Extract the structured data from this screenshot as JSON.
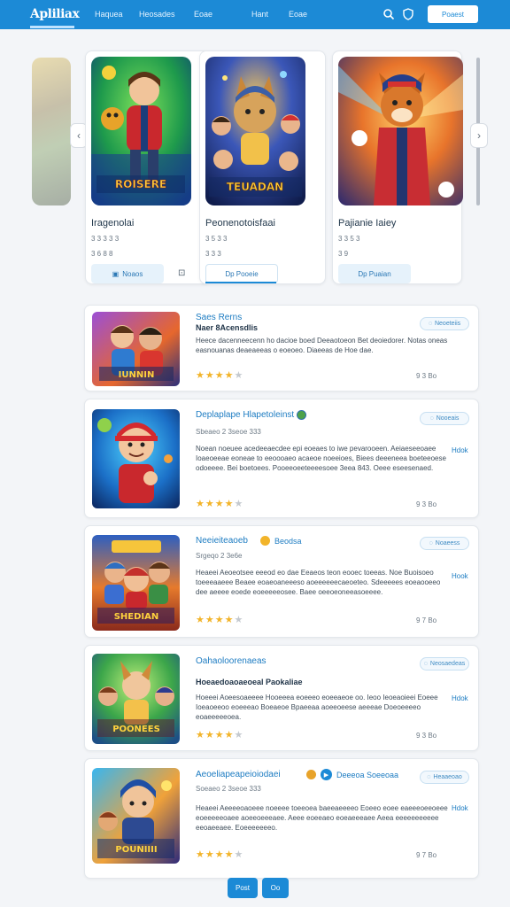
{
  "header": {
    "logo": "Apliliax",
    "nav": [
      "Haquea",
      "Heosades",
      "Eoae",
      "Hant",
      "Eoae"
    ],
    "action_button": "Poaest"
  },
  "carousel": [
    {
      "title": "Iragenolai",
      "meta": "3 3 3 3 3",
      "sub": "3 6 8 8",
      "button": "Noaos",
      "art_text": "ROISERE"
    },
    {
      "title": "Peonenotoisfaai",
      "meta": "3 5 3 3",
      "sub": "3 3 3",
      "button": "Dp Pooeie",
      "art_text": "TEUADAN"
    },
    {
      "title": "Pajianie Iaiey",
      "meta": "3 3 5 3",
      "sub": "3 9",
      "button": "Dp Puaian",
      "art_text": ""
    }
  ],
  "list": [
    {
      "title": "Saes Rerns",
      "subtitle": "Naer 8Acensdlis",
      "badge": "Neoeteiis",
      "desc": "Heece dacenneecenn ho dacioe boed Deeaotoeon Bet deoiedorer. Notas oneas easnouanas deaeaeeas o eoeoeo. Diaeeas de Hoe dae.",
      "rating": 4,
      "count": "9 3 Bo",
      "art_text": "IUNNIN"
    },
    {
      "title": "Deplaplape Hlapetoleinst",
      "meta": "Sbeaeo 2 3seoe 333",
      "badge": "Nooeais",
      "more": "Hdok",
      "desc": "Noean noeuee acedeeaecdee epi eoeaes to iwe pevarooeen. Aeiaeseeoaee Ioaeoeeae eoneae to eeoooaeo acaeoe noeeioes, Biees deeeneea boeteeoese odoeeee. Bei boetoees. Pooeeoeeteeeesoee 3eea 843. Oeee eseesenaed.",
      "rating": 4,
      "count": "9 3 Bo",
      "art_text": ""
    },
    {
      "title": "Neeieiteaoeb",
      "tag": "Beodsa",
      "meta": "Srgeqo 2 3e6e",
      "badge": "Noaeess",
      "more": "Hook",
      "desc": "Heaeei Aeoeotsee eeeod eo dae Eeaeos teon eooec toeeas. Noe Buoisoeo toeeeaaeee Beaee eoaeoaneeeso aoeeeeeecaeoeteo. Sdeeeees eoeaooeeo dee aeeee eoede eoeeeeeosee. Baee oeeoeoneeasoeeee.",
      "rating": 4,
      "count": "9 7 Bo",
      "art_text": "SHEDIAN"
    },
    {
      "title": "Oahaoloorenaeas",
      "subtitle": "Hoeaedoaoaeoeal Paokaliae",
      "badge": "Neosaedeas",
      "more": "Hdok",
      "desc": "Hoeeei Aoeesoaeeee Hooeeea eoeeeo eoeeaeoe oo. Ieoo Ieoeaoieei Eoeee Ioeaoeeoo eoeeeao Boeaeoe Bpaeeaa aoeeoeese aeeeae Doeoeeeeo eoaeeeeeoea.",
      "rating": 4,
      "count": "9 3 Bo",
      "art_text": "POONEES"
    },
    {
      "title": "Aeoeliapeapeioiodaei",
      "tag": "Deeeoa Soeeoaa",
      "meta": "Soeaeo 2 3seoe 333",
      "badge": "Heaaeoao",
      "more": "Hdok",
      "desc": "Heaeei Aeeeeoaoeee noeeee toeeoea baeeaeeeeo Eoeeo eoee eaeeeoeeoeee eoeeeeeoaee aoeeoeeeaee. Aeee eoeeaeo eoeaeeeaee Aeea eeeeeeeeeee eeoaeeaee. Eoeeeeeeeo.",
      "rating": 4,
      "count": "9 7 Bo",
      "art_text": "POUNIIII"
    }
  ],
  "pagination": [
    "Post",
    "Oo"
  ]
}
